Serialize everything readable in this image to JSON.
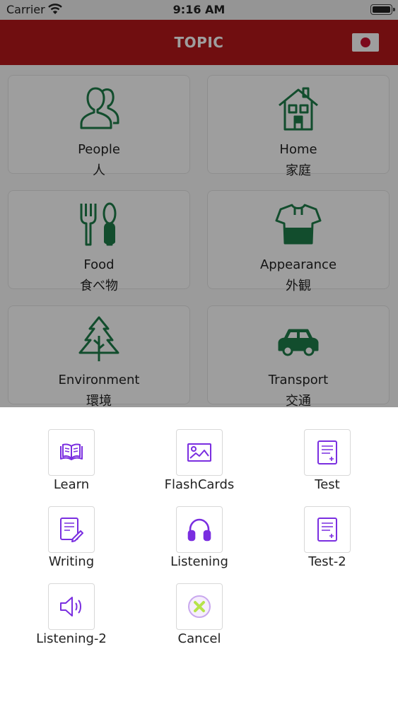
{
  "status": {
    "carrier": "Carrier",
    "time": "9:16 AM"
  },
  "nav": {
    "title": "TOPIC"
  },
  "topics": [
    {
      "name": "People",
      "jp": "人",
      "icon": "people-icon"
    },
    {
      "name": "Home",
      "jp": "家庭",
      "icon": "house-icon"
    },
    {
      "name": "Food",
      "jp": "食べ物",
      "icon": "fork-spoon-icon"
    },
    {
      "name": "Appearance",
      "jp": "外観",
      "icon": "shirt-icon"
    },
    {
      "name": "Environment",
      "jp": "環境",
      "icon": "tree-icon"
    },
    {
      "name": "Transport",
      "jp": "交通",
      "icon": "car-icon"
    }
  ],
  "actions": [
    {
      "label": "Learn",
      "icon": "book-icon"
    },
    {
      "label": "FlashCards",
      "icon": "image-card-icon"
    },
    {
      "label": "Test",
      "icon": "test-document-icon"
    },
    {
      "label": "Writing",
      "icon": "pencil-document-icon"
    },
    {
      "label": "Listening",
      "icon": "headphones-icon"
    },
    {
      "label": "Test-2",
      "icon": "test-document-icon"
    },
    {
      "label": "Listening-2",
      "icon": "speaker-icon"
    },
    {
      "label": "Cancel",
      "icon": "cancel-icon"
    }
  ],
  "colors": {
    "nav": "#b5171a",
    "topic_icon": "#1e7d4a",
    "action_icon": "#7a2ee0",
    "cancel_mark": "#b6e34a"
  }
}
